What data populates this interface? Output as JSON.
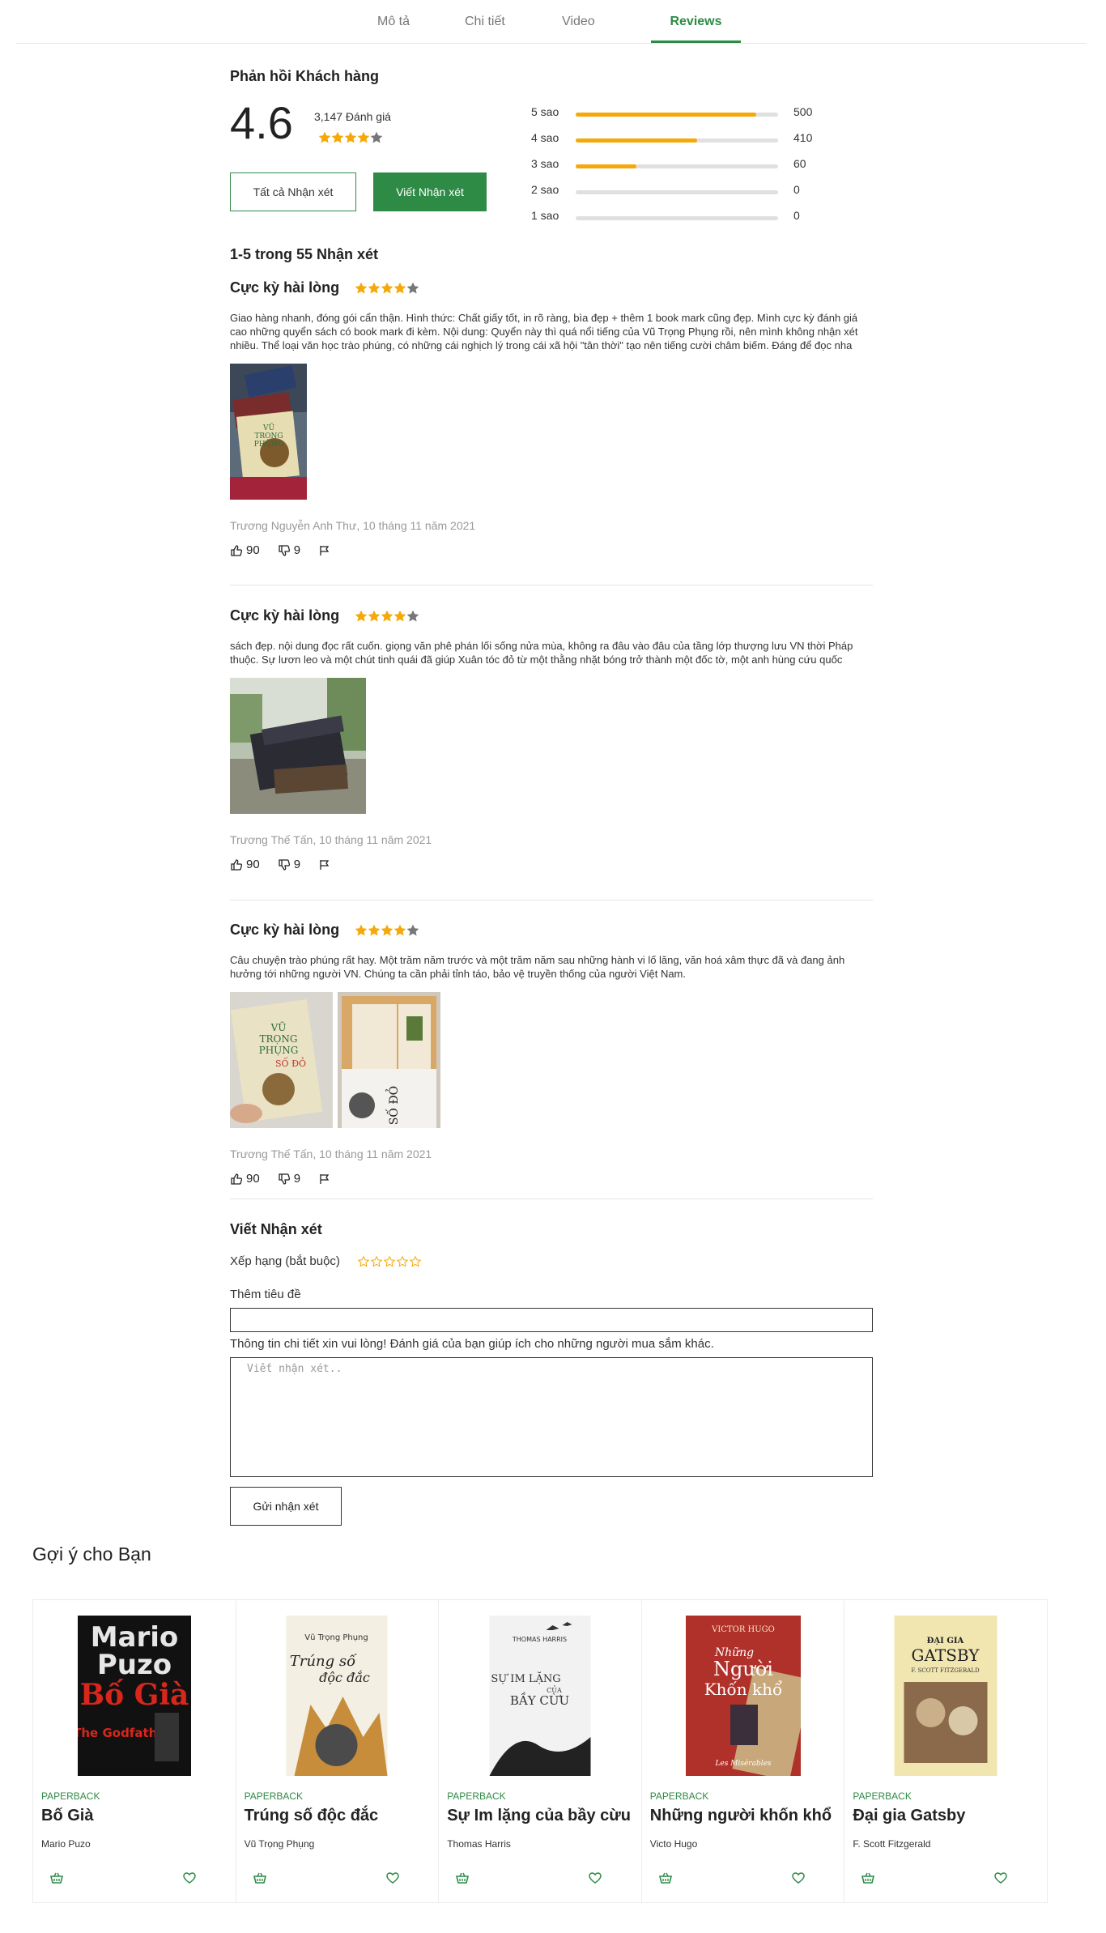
{
  "tabs": [
    {
      "label": "Mô tả"
    },
    {
      "label": "Chi tiết"
    },
    {
      "label": "Video"
    },
    {
      "label": "Reviews"
    }
  ],
  "summary": {
    "title": "Phản hồi Khách hàng",
    "rating": "4.6",
    "count_text": "3,147 Đánh giá",
    "stars_filled": 4,
    "all_reviews_button": "Tất cả Nhận xét",
    "write_review_button": "Viết Nhận xét",
    "distribution": [
      {
        "label": "5 sao",
        "count": "500",
        "fraction": 0.89
      },
      {
        "label": "4 sao",
        "count": "410",
        "fraction": 0.6
      },
      {
        "label": "3 sao",
        "count": "60",
        "fraction": 0.3
      },
      {
        "label": "2 sao",
        "count": "0",
        "fraction": 0
      },
      {
        "label": "1 sao",
        "count": "0",
        "fraction": 0
      }
    ]
  },
  "reviews_range": "1-5 trong 55 Nhận xét",
  "reviews": [
    {
      "title": "Cực kỳ hài lòng",
      "stars_filled": 4,
      "body": "Giao hàng nhanh, đóng gói cẩn thận. Hình thức: Chất giấy tốt, in rõ ràng, bìa đẹp + thêm 1 book mark cũng đẹp. Mình cực kỳ đánh giá cao những quyển sách có book mark đi kèm. Nội dung: Quyển này thì quá nổi tiếng của Vũ Trọng Phụng rồi, nên mình không nhận xét nhiều. Thể loại văn học trào phúng, có những cái nghịch lý trong cái xã hội \"tân thời\" tạo nên tiếng cười châm biếm. Đáng để đọc nha",
      "author_date": "Trương Nguyễn Anh Thư, 10 tháng 11 năm 2021",
      "likes": "90",
      "dislikes": "9"
    },
    {
      "title": "Cực kỳ hài lòng",
      "stars_filled": 4,
      "body": "sách đẹp. nội dung đọc rất cuốn. giọng văn phê phán lối sống nửa mùa, không ra đâu vào đâu của tầng lớp thượng lưu VN thời Pháp thuộc. Sự lươn leo và một chút tinh quái đã giúp Xuân tóc đỏ từ một thằng nhặt bóng trở thành một đốc tờ, một anh hùng cứu quốc",
      "author_date": "Trương Thế Tấn, 10 tháng 11 năm 2021",
      "likes": "90",
      "dislikes": "9"
    },
    {
      "title": "Cực kỳ hài lòng",
      "stars_filled": 4,
      "body": "Câu chuyện trào phúng rất hay. Một trăm năm trước và một trăm năm sau những hành vi lố lăng, văn hoá xâm thực đã và đang ảnh hưởng tới những người VN. Chúng ta cần phải tỉnh táo, bảo vệ truyền thống của người Việt Nam.",
      "author_date": "Trương Thế Tấn, 10 tháng 11 năm 2021",
      "likes": "90",
      "dislikes": "9"
    }
  ],
  "photo_texts": {
    "vu": "VŨ",
    "trong": "TRỌNG",
    "phung": "PHỤNG",
    "sodo": "SỐ ĐỎ",
    "sodo2": "SỐ ĐỎ"
  },
  "write_form": {
    "title": "Viết Nhận xét",
    "rating_label": "Xếp hạng (bắt buộc)",
    "headline_label": "Thêm tiêu đề",
    "details_label": "Thông tin chi tiết xin vui lòng! Đánh giá của bạn giúp ích cho những người mua sắm khác.",
    "textarea_placeholder": "Viết nhận xét..",
    "submit_button": "Gửi nhận xét"
  },
  "suggestions": {
    "title": "Gợi ý cho Bạn",
    "items": [
      {
        "type": "PAPERBACK",
        "title": "Bố Già",
        "author": "Mario Puzo",
        "cover_lines": [
          "Mario",
          "Puzo",
          "Bố Già",
          "The Godfather"
        ]
      },
      {
        "type": "PAPERBACK",
        "title": "Trúng số độc đắc",
        "author": "Vũ Trọng Phụng",
        "cover_lines": [
          "Vũ Trọng Phụng",
          "Trúng số",
          "độc đắc"
        ]
      },
      {
        "type": "PAPERBACK",
        "title": "Sự Im lặng của bầy cừu",
        "author": "Thomas Harris",
        "cover_lines": [
          "THOMAS HARRIS",
          "SỰ IM LẶNG",
          "CỦA",
          "BẦY CỪU"
        ]
      },
      {
        "type": "PAPERBACK",
        "title": "Những người khốn khổ",
        "author": "Victo Hugo",
        "cover_lines": [
          "VICTOR HUGO",
          "Những",
          "Người",
          "Khốn khổ",
          "Les Misérables"
        ]
      },
      {
        "type": "PAPERBACK",
        "title": "Đại gia Gatsby",
        "author": "F. Scott Fitzgerald",
        "cover_lines": [
          "ĐẠI GIA",
          "GATSBY",
          "F. SCOTT FITZGERALD"
        ]
      }
    ]
  },
  "colors": {
    "accent_green": "#2e8b46",
    "star_orange": "#f5a80a",
    "star_grey": "#777777"
  }
}
